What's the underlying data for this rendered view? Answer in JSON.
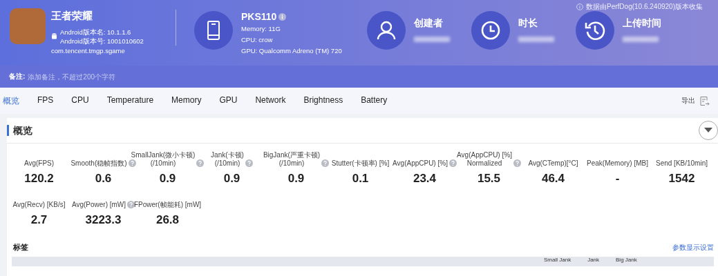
{
  "app": {
    "name": "王者荣耀",
    "version_name": "Android版本名: 10.1.1.6",
    "version_code": "Android版本号: 1001010602",
    "package": "com.tencent.tmgp.sgame"
  },
  "device": {
    "model": "PKS110",
    "specs": [
      "Memory: 11G",
      "CPU: crow",
      "GPU: Qualcomm Adreno (TM) 720"
    ]
  },
  "source_note": "数据由PerfDog(10.6.240920)版本收集",
  "info_items": [
    {
      "kind": "user",
      "label": "创建者"
    },
    {
      "kind": "clock",
      "label": "时长"
    },
    {
      "kind": "history",
      "label": "上传时间"
    }
  ],
  "remark": {
    "label": "备注:",
    "placeholder": "添加备注，不超过200个字符"
  },
  "tabs": [
    {
      "label": "概览",
      "selected": true
    },
    {
      "label": "FPS",
      "selected": false
    },
    {
      "label": "CPU",
      "selected": false
    },
    {
      "label": "Temperature",
      "selected": false
    },
    {
      "label": "Memory",
      "selected": false
    },
    {
      "label": "GPU",
      "selected": false
    },
    {
      "label": "Network",
      "selected": false
    },
    {
      "label": "Brightness",
      "selected": false
    },
    {
      "label": "Battery",
      "selected": false
    }
  ],
  "export_label": "导出",
  "section_title": "概览",
  "metrics": [
    {
      "label": "Avg(FPS)",
      "help": false,
      "value": "120.2"
    },
    {
      "label": "Smooth(稳帧指数)",
      "help": true,
      "value": "0.6"
    },
    {
      "label": "SmallJank(微小卡顿)\n(/10min)",
      "help": true,
      "value": "0.9"
    },
    {
      "label": "Jank(卡顿)\n(/10min)",
      "help": true,
      "value": "0.9"
    },
    {
      "label": "BigJank(严重卡顿)\n(/10min)",
      "help": true,
      "value": "0.9"
    },
    {
      "label": "Stutter(卡顿率) [%]",
      "help": false,
      "value": "0.1"
    },
    {
      "label": "Avg(AppCPU) [%]",
      "help": true,
      "value": "23.4"
    },
    {
      "label": "Avg(AppCPU) [%]\nNormalized",
      "help": true,
      "value": "15.5"
    },
    {
      "label": "Avg(CTemp)[°C]",
      "help": false,
      "value": "46.4"
    },
    {
      "label": "Peak(Memory) [MB]",
      "help": false,
      "value": "-"
    },
    {
      "label": "Send [KB/10min]",
      "help": false,
      "value": "1542"
    },
    {
      "label": "Avg(Recv) [KB/s]",
      "help": false,
      "value": "2.7"
    },
    {
      "label": "Avg(Power) [mW]",
      "help": true,
      "value": "3223.3"
    },
    {
      "label": "FPower(帧能耗) [mW]",
      "help": false,
      "value": "26.8"
    }
  ],
  "tags_title": "标签",
  "settings_link": "参数显示设置",
  "table": {
    "columns": [
      "Small Jank",
      "Jank",
      "Big Jank"
    ]
  }
}
